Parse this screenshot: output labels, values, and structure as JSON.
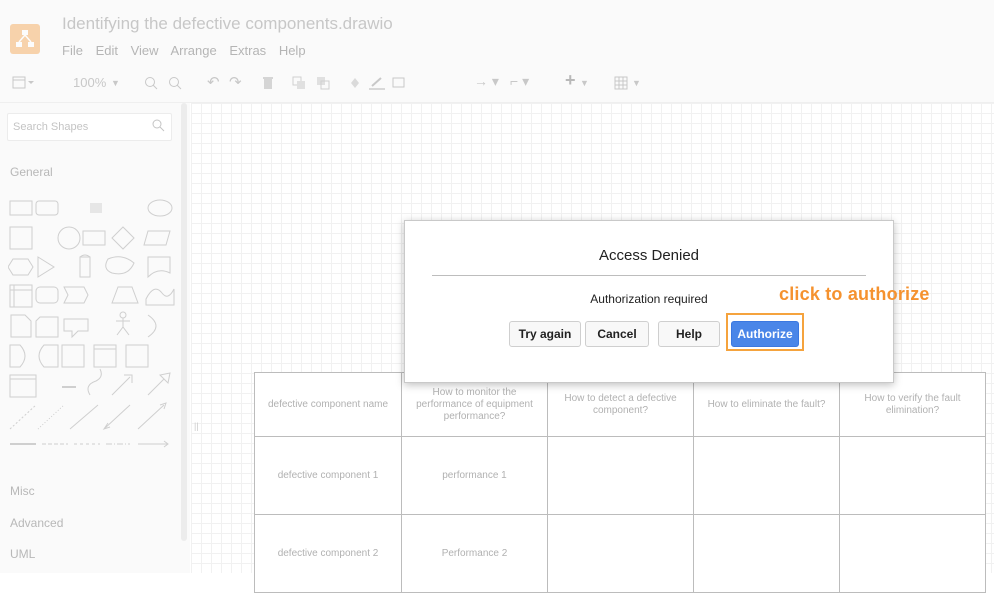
{
  "app": {
    "title": "Identifying the defective components.drawio",
    "menu": [
      "File",
      "Edit",
      "View",
      "Arrange",
      "Extras",
      "Help"
    ],
    "brand_color": "#f08705"
  },
  "toolbar": {
    "zoom": "100%",
    "icons": [
      "format-panel-icon",
      "zoom-in-icon",
      "zoom-out-icon",
      "undo-icon",
      "redo-icon",
      "delete-icon",
      "to-front-icon",
      "to-back-icon",
      "fill-icon",
      "line-color-icon",
      "shadow-icon",
      "connection-icon",
      "waypoints-icon",
      "insert-icon",
      "table-icon"
    ]
  },
  "sidebar": {
    "search_placeholder": "Search Shapes",
    "sections": [
      "General",
      "Misc",
      "Advanced",
      "UML"
    ]
  },
  "table": {
    "headers": [
      "defective component name",
      "How to monitor the performance of equipment performance?",
      "How to detect a defective component?",
      "How to eliminate the fault?",
      "How to verify the fault elimination?"
    ],
    "rows": [
      [
        "defective component 1",
        "performance 1",
        "",
        "",
        ""
      ],
      [
        "defective component 2",
        "Performance 2",
        "",
        "",
        ""
      ]
    ]
  },
  "dialog": {
    "title": "Access Denied",
    "message": "Authorization required",
    "buttons": {
      "try_again": "Try again",
      "cancel": "Cancel",
      "help": "Help",
      "authorize": "Authorize"
    },
    "primary_color": "#4a86e8"
  },
  "annotation": {
    "text": "click to authorize",
    "color": "#f5922f"
  }
}
